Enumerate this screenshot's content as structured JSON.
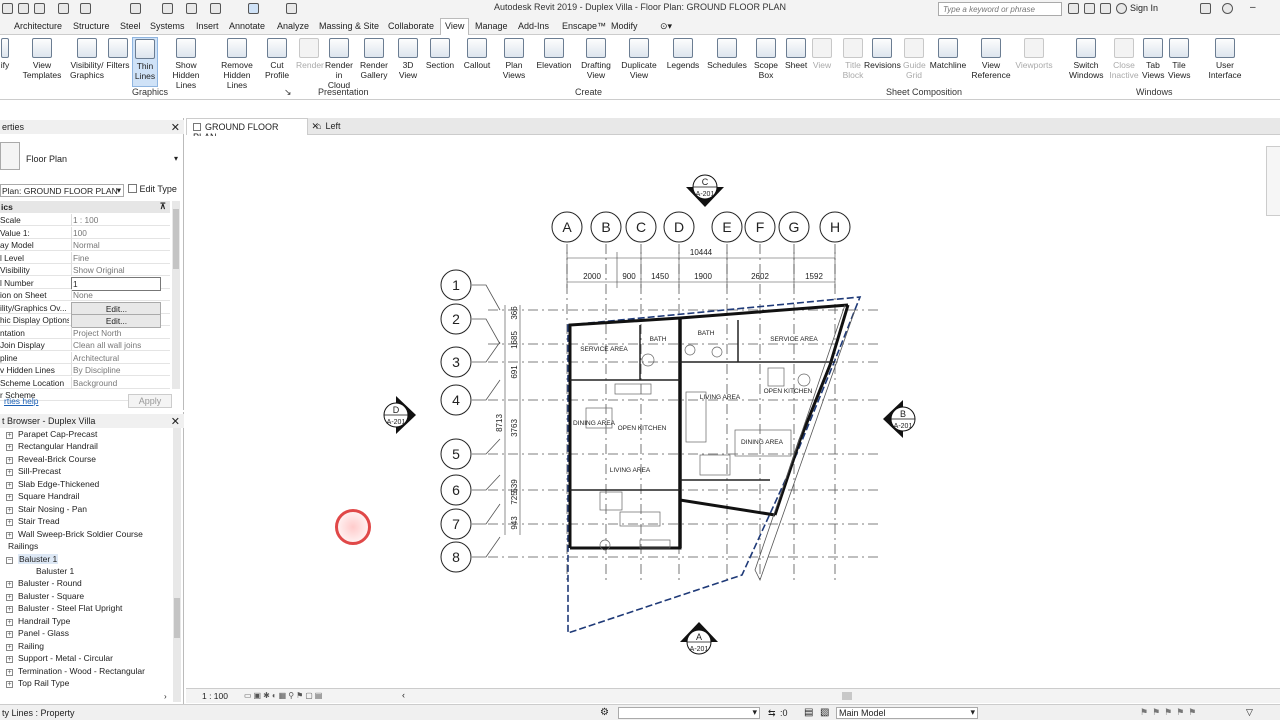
{
  "window": {
    "title": "Autodesk Revit 2019 - Duplex Villa - Floor Plan: GROUND FLOOR PLAN"
  },
  "search": {
    "placeholder": "Type a keyword or phrase"
  },
  "signin": {
    "label": "Sign In"
  },
  "tabs": [
    "Architecture",
    "Structure",
    "Steel",
    "Systems",
    "Insert",
    "Annotate",
    "Analyze",
    "Massing & Site",
    "Collaborate",
    "View",
    "Manage",
    "Add-Ins",
    "Enscape™",
    "Modify"
  ],
  "active_tab": "View",
  "ribbon": {
    "buttons": [
      {
        "label": "ify",
        "state": "on"
      },
      {
        "label": "View\nTemplates",
        "state": "on"
      },
      {
        "label": "Visibility/\nGraphics",
        "state": "on"
      },
      {
        "label": "Filters",
        "state": "on"
      },
      {
        "label": "Thin\nLines",
        "state": "selected"
      },
      {
        "label": "Show\nHidden Lines",
        "state": "on"
      },
      {
        "label": "Remove\nHidden Lines",
        "state": "on"
      },
      {
        "label": "Cut\nProfile",
        "state": "on"
      },
      {
        "label": "Render",
        "state": "disabled"
      },
      {
        "label": "Render\nin Cloud",
        "state": "on"
      },
      {
        "label": "Render\nGallery",
        "state": "on"
      },
      {
        "label": "3D\nView",
        "state": "on"
      },
      {
        "label": "Section",
        "state": "on"
      },
      {
        "label": "Callout",
        "state": "on"
      },
      {
        "label": "Plan\nViews",
        "state": "on"
      },
      {
        "label": "Elevation",
        "state": "on"
      },
      {
        "label": "Drafting\nView",
        "state": "on"
      },
      {
        "label": "Duplicate\nView",
        "state": "on"
      },
      {
        "label": "Legends",
        "state": "on"
      },
      {
        "label": "Schedules",
        "state": "on"
      },
      {
        "label": "Scope\nBox",
        "state": "on"
      },
      {
        "label": "Sheet",
        "state": "on"
      },
      {
        "label": "View",
        "state": "disabled"
      },
      {
        "label": "Title\nBlock",
        "state": "disabled"
      },
      {
        "label": "Revisions",
        "state": "on"
      },
      {
        "label": "Guide\nGrid",
        "state": "disabled"
      },
      {
        "label": "Matchline",
        "state": "on"
      },
      {
        "label": "View\nReference",
        "state": "on"
      },
      {
        "label": "Viewports",
        "state": "disabled"
      },
      {
        "label": "Switch\nWindows",
        "state": "on"
      },
      {
        "label": "Close\nInactive",
        "state": "disabled"
      },
      {
        "label": "Tab\nViews",
        "state": "on"
      },
      {
        "label": "Tile\nViews",
        "state": "on"
      },
      {
        "label": "User\nInterface",
        "state": "on"
      }
    ],
    "panels": [
      "Graphics",
      "Presentation",
      "Create",
      "Sheet Composition",
      "Windows"
    ]
  },
  "properties": {
    "title": "erties",
    "type_name": "Floor Plan",
    "view_selector": "Plan: GROUND FLOOR PLAN",
    "edit_type": "Edit Type",
    "section": "ics",
    "rows": [
      {
        "k": "Scale",
        "v": "1 : 100",
        "kind": "text"
      },
      {
        "k": "Value   1:",
        "v": "100",
        "kind": "text"
      },
      {
        "k": "ay Model",
        "v": "Normal",
        "kind": "text"
      },
      {
        "k": "l Level",
        "v": "Fine",
        "kind": "text"
      },
      {
        "k": "Visibility",
        "v": "Show Original",
        "kind": "text"
      },
      {
        "k": "l Number",
        "v": "1",
        "kind": "input"
      },
      {
        "k": "ion on Sheet",
        "v": "None",
        "kind": "text"
      },
      {
        "k": "ility/Graphics Ov...",
        "v": "Edit...",
        "kind": "button"
      },
      {
        "k": "hic Display Options",
        "v": "Edit...",
        "kind": "button"
      },
      {
        "k": "ntation",
        "v": "Project North",
        "kind": "text"
      },
      {
        "k": "Join Display",
        "v": "Clean all wall joins",
        "kind": "text"
      },
      {
        "k": "pline",
        "v": "Architectural",
        "kind": "text"
      },
      {
        "k": "v Hidden Lines",
        "v": "By Discipline",
        "kind": "text"
      },
      {
        "k": "Scheme Location",
        "v": "Background",
        "kind": "text"
      },
      {
        "k": "r Scheme",
        "v": "",
        "kind": "text"
      }
    ],
    "help": "rties help",
    "apply": "Apply"
  },
  "browser": {
    "title": "t Browser - Duplex Villa",
    "items": [
      {
        "label": "Parapet Cap-Precast",
        "ind": 1,
        "pm": "+"
      },
      {
        "label": "Rectangular Handrail",
        "ind": 1,
        "pm": "+"
      },
      {
        "label": "Reveal-Brick Course",
        "ind": 1,
        "pm": "+"
      },
      {
        "label": "Sill-Precast",
        "ind": 1,
        "pm": "+"
      },
      {
        "label": "Slab Edge-Thickened",
        "ind": 1,
        "pm": "+"
      },
      {
        "label": "Square Handrail",
        "ind": 1,
        "pm": "+"
      },
      {
        "label": "Stair Nosing - Pan",
        "ind": 1,
        "pm": "+"
      },
      {
        "label": "Stair Tread",
        "ind": 1,
        "pm": "+"
      },
      {
        "label": "Wall Sweep-Brick Soldier Course",
        "ind": 1,
        "pm": "+"
      },
      {
        "label": "Railings",
        "ind": 0,
        "pm": ""
      },
      {
        "label": "Baluster 1",
        "ind": 1,
        "pm": "−",
        "sel": true
      },
      {
        "label": "Baluster 1",
        "ind": 2,
        "pm": ""
      },
      {
        "label": "Baluster - Round",
        "ind": 1,
        "pm": "+"
      },
      {
        "label": "Baluster - Square",
        "ind": 1,
        "pm": "+"
      },
      {
        "label": "Baluster - Steel Flat Upright",
        "ind": 1,
        "pm": "+"
      },
      {
        "label": "Handrail Type",
        "ind": 1,
        "pm": "+"
      },
      {
        "label": "Panel - Glass",
        "ind": 1,
        "pm": "+"
      },
      {
        "label": "Railing",
        "ind": 1,
        "pm": "+"
      },
      {
        "label": "Support - Metal - Circular",
        "ind": 1,
        "pm": "+"
      },
      {
        "label": "Termination - Wood - Rectangular",
        "ind": 1,
        "pm": "+"
      },
      {
        "label": "Top Rail Type",
        "ind": 1,
        "pm": "+"
      }
    ]
  },
  "doc_tabs": [
    "GROUND FLOOR PLAN",
    "Left"
  ],
  "plan": {
    "grid_cols": [
      "A",
      "B",
      "C",
      "D",
      "E",
      "F",
      "G",
      "H"
    ],
    "grid_rows": [
      "1",
      "2",
      "3",
      "4",
      "5",
      "6",
      "7",
      "8"
    ],
    "overall_dim": "10444",
    "col_dims": [
      "2000",
      "900",
      "1450",
      "1900",
      "2602",
      "1592"
    ],
    "row_total": "8713",
    "row_dims": [
      "366",
      "1685",
      "691",
      "3763",
      "539",
      "725",
      "943"
    ],
    "rooms": [
      "SERVICE AREA",
      "BATH",
      "BATH",
      "SERVICE AREA",
      "OPEN KITCHEN",
      "LIVING AREA",
      "OPEN KITCHEN",
      "DINING AREA",
      "DINING AREA",
      "LIVING AREA"
    ],
    "sections": [
      {
        "letter": "C",
        "sheet": "A-201"
      },
      {
        "letter": "D",
        "sheet": "A-201"
      },
      {
        "letter": "B",
        "sheet": "A-201"
      },
      {
        "letter": "A",
        "sheet": "A-201"
      }
    ]
  },
  "view_control": {
    "scale": "1 : 100"
  },
  "status": {
    "text": "ty Lines : Property",
    "zero": ":0",
    "model": "Main Model"
  }
}
